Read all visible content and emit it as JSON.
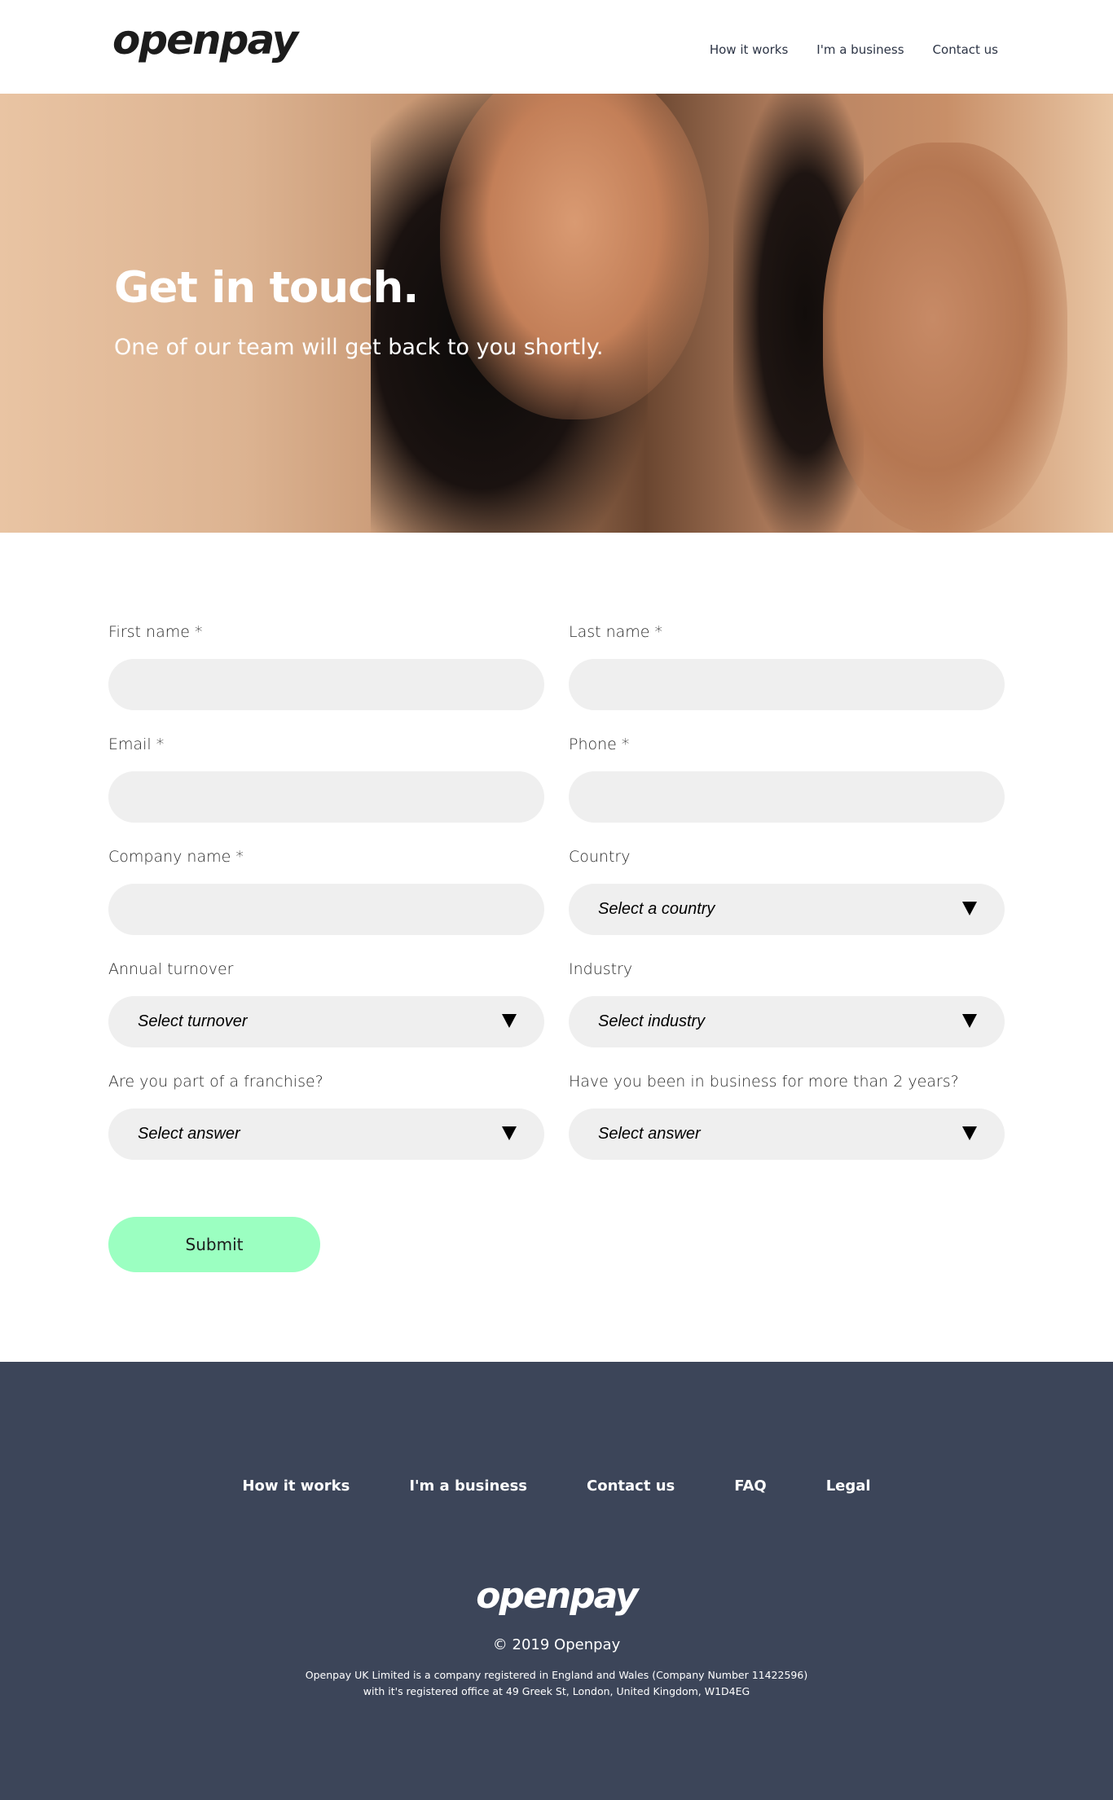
{
  "header": {
    "logo": "openpay",
    "nav": [
      "How it works",
      "I'm a business",
      "Contact us"
    ]
  },
  "hero": {
    "title": "Get in touch.",
    "subtitle": "One of our team will get back to you shortly."
  },
  "form": {
    "first_name": {
      "label": "First name *",
      "value": ""
    },
    "last_name": {
      "label": "Last name *",
      "value": ""
    },
    "email": {
      "label": "Email *",
      "value": ""
    },
    "phone": {
      "label": "Phone *",
      "value": ""
    },
    "company_name": {
      "label": "Company name *",
      "value": ""
    },
    "country": {
      "label": "Country",
      "selected": "Select a country"
    },
    "annual_turnover": {
      "label": "Annual turnover",
      "selected": "Select turnover"
    },
    "industry": {
      "label": "Industry",
      "selected": "Select industry"
    },
    "franchise": {
      "label": "Are you part of a franchise?",
      "selected": "Select answer"
    },
    "years_in_business": {
      "label": "Have you been in business for more than 2 years?",
      "selected": "Select answer"
    },
    "submit_label": "Submit",
    "submit_color": "#9bffc1"
  },
  "footer": {
    "nav": [
      "How it works",
      "I'm a business",
      "Contact us",
      "FAQ",
      "Legal"
    ],
    "logo": "openpay",
    "copyright": "© 2019 Openpay",
    "legal_line1": "Openpay UK Limited is a company registered in England and Wales (Company Number 11422596)",
    "legal_line2": "with it's registered office at 49 Greek St, London, United Kingdom, W1D4EG",
    "background": "#3c4559",
    "accent": "#4fe3b0"
  }
}
